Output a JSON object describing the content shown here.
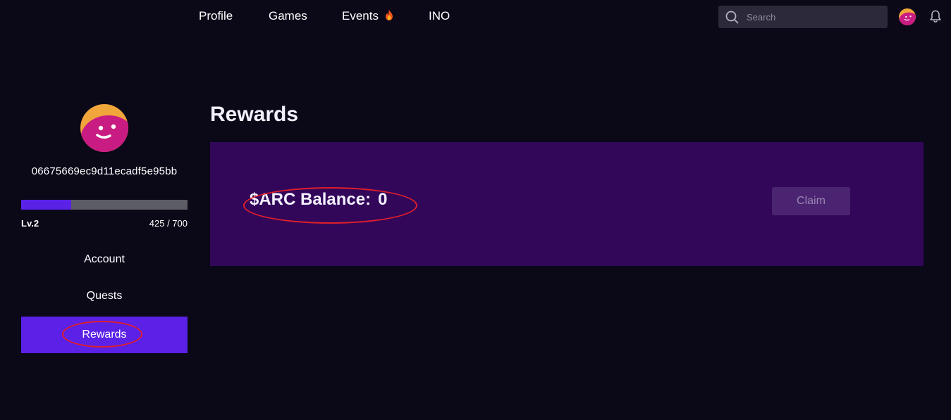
{
  "nav": {
    "links": [
      {
        "label": "Profile"
      },
      {
        "label": "Games"
      },
      {
        "label": "Events",
        "icon": "fire-icon"
      },
      {
        "label": "INO"
      }
    ],
    "search": {
      "placeholder": "Search"
    }
  },
  "sidebar": {
    "user_id": "06675669ec9d11ecadf5e95bb",
    "level": "Lv.2",
    "xp_text": "425 / 700",
    "xp_fraction": 0.3,
    "items": [
      {
        "label": "Account"
      },
      {
        "label": "Quests"
      },
      {
        "label": "Rewards",
        "active": true
      }
    ]
  },
  "main": {
    "title": "Rewards",
    "balance_label": "$ARC Balance:",
    "balance_value": "0",
    "claim_label": "Claim"
  },
  "colors": {
    "background": "#0b0818",
    "accent": "#5b21e6",
    "panel": "#32075a",
    "annotation": "#e01e2a"
  }
}
